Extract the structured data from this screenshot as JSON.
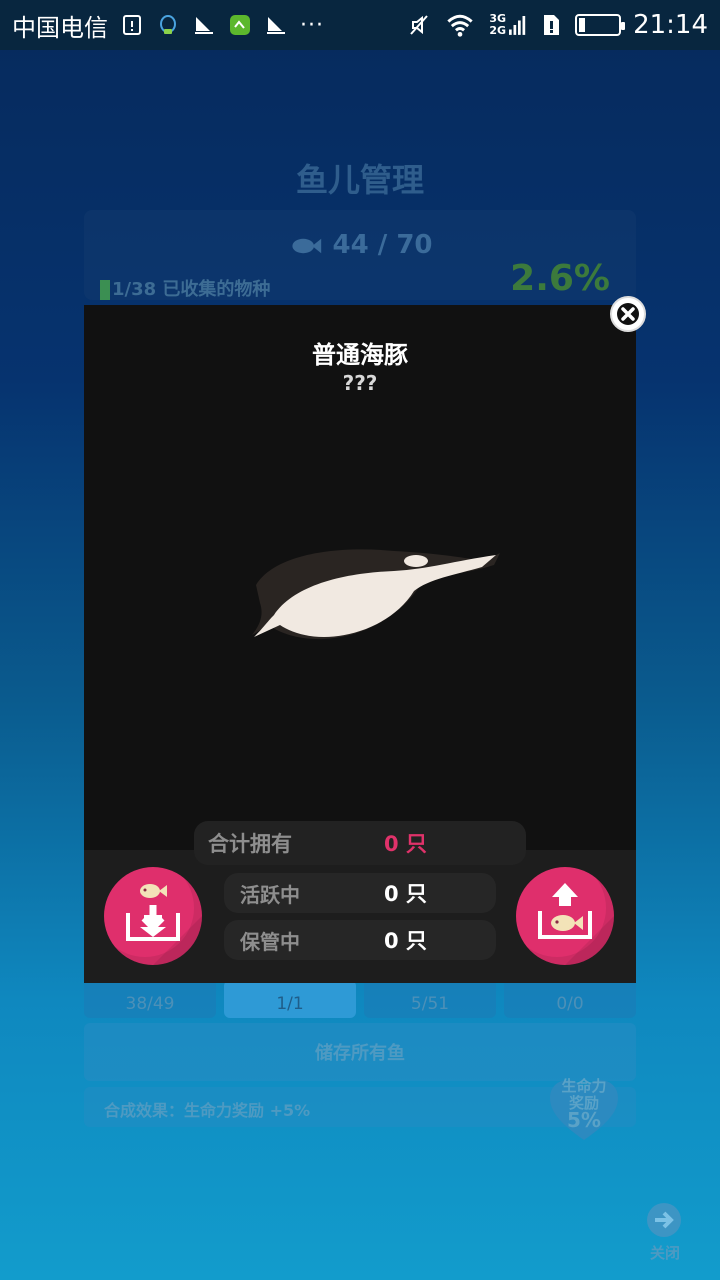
{
  "status_bar": {
    "carrier": "中国电信",
    "more": "···",
    "network_top": "3G",
    "network_bottom": "2G",
    "time": "21:14"
  },
  "background": {
    "title": "鱼儿管理",
    "fish_count": "44 / 70",
    "collected": "1/38 已收集的物种",
    "percent": "2.6%",
    "tabs": [
      {
        "value": "38/49"
      },
      {
        "value": "1/1"
      },
      {
        "value": "5/51"
      },
      {
        "value": "0/0"
      }
    ],
    "store_all": "储存所有鱼",
    "effect": "合成效果：生命力奖励 +5%",
    "heart_label_1": "生命力",
    "heart_label_2": "奖励",
    "heart_pct": "5%",
    "close_label": "关闭"
  },
  "modal": {
    "title": "普通海豚",
    "subtitle": "???",
    "stats": {
      "total_label": "合计拥有",
      "total_value": "0 只",
      "active_label": "活跃中",
      "active_value": "0 只",
      "stored_label": "保管中",
      "stored_value": "0 只"
    }
  },
  "colors": {
    "accent_pink": "#df2f6c",
    "modal_bg": "#111111"
  }
}
